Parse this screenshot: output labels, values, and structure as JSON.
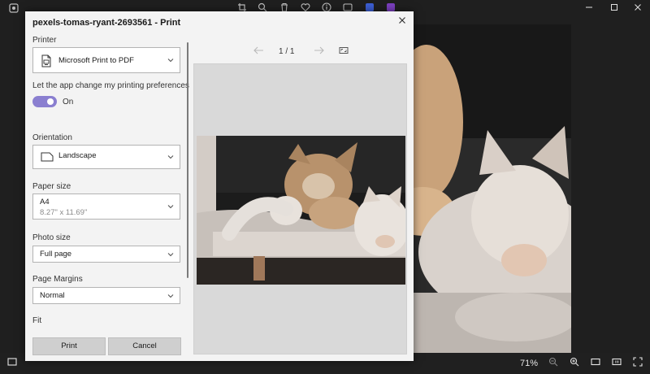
{
  "app": {
    "zoom_label": "71%"
  },
  "dialog": {
    "title": "pexels-tomas-ryant-2693561 - Print",
    "printer": {
      "label": "Printer",
      "value": "Microsoft Print to PDF"
    },
    "preferences": {
      "label": "Let the app change my printing preferences",
      "state": "On"
    },
    "orientation": {
      "label": "Orientation",
      "value": "Landscape"
    },
    "paper_size": {
      "label": "Paper size",
      "value": "A4",
      "detail": "8.27\" x 11.69\""
    },
    "photo_size": {
      "label": "Photo size",
      "value": "Full page"
    },
    "page_margins": {
      "label": "Page Margins",
      "value": "Normal"
    },
    "fit": {
      "label": "Fit"
    },
    "buttons": {
      "print": "Print",
      "cancel": "Cancel"
    },
    "preview": {
      "page_indicator": "1 / 1"
    }
  },
  "icons": {
    "printer": "printer-icon",
    "orientation": "landscape-page-icon",
    "chevron": "chevron-down-icon",
    "close": "close-icon"
  },
  "colors": {
    "toggle_on": "#8a7fd0",
    "dialog_bg": "#f3f3f3",
    "preview_bg": "#d9d9d9",
    "app_bg": "#1f1f1f"
  }
}
